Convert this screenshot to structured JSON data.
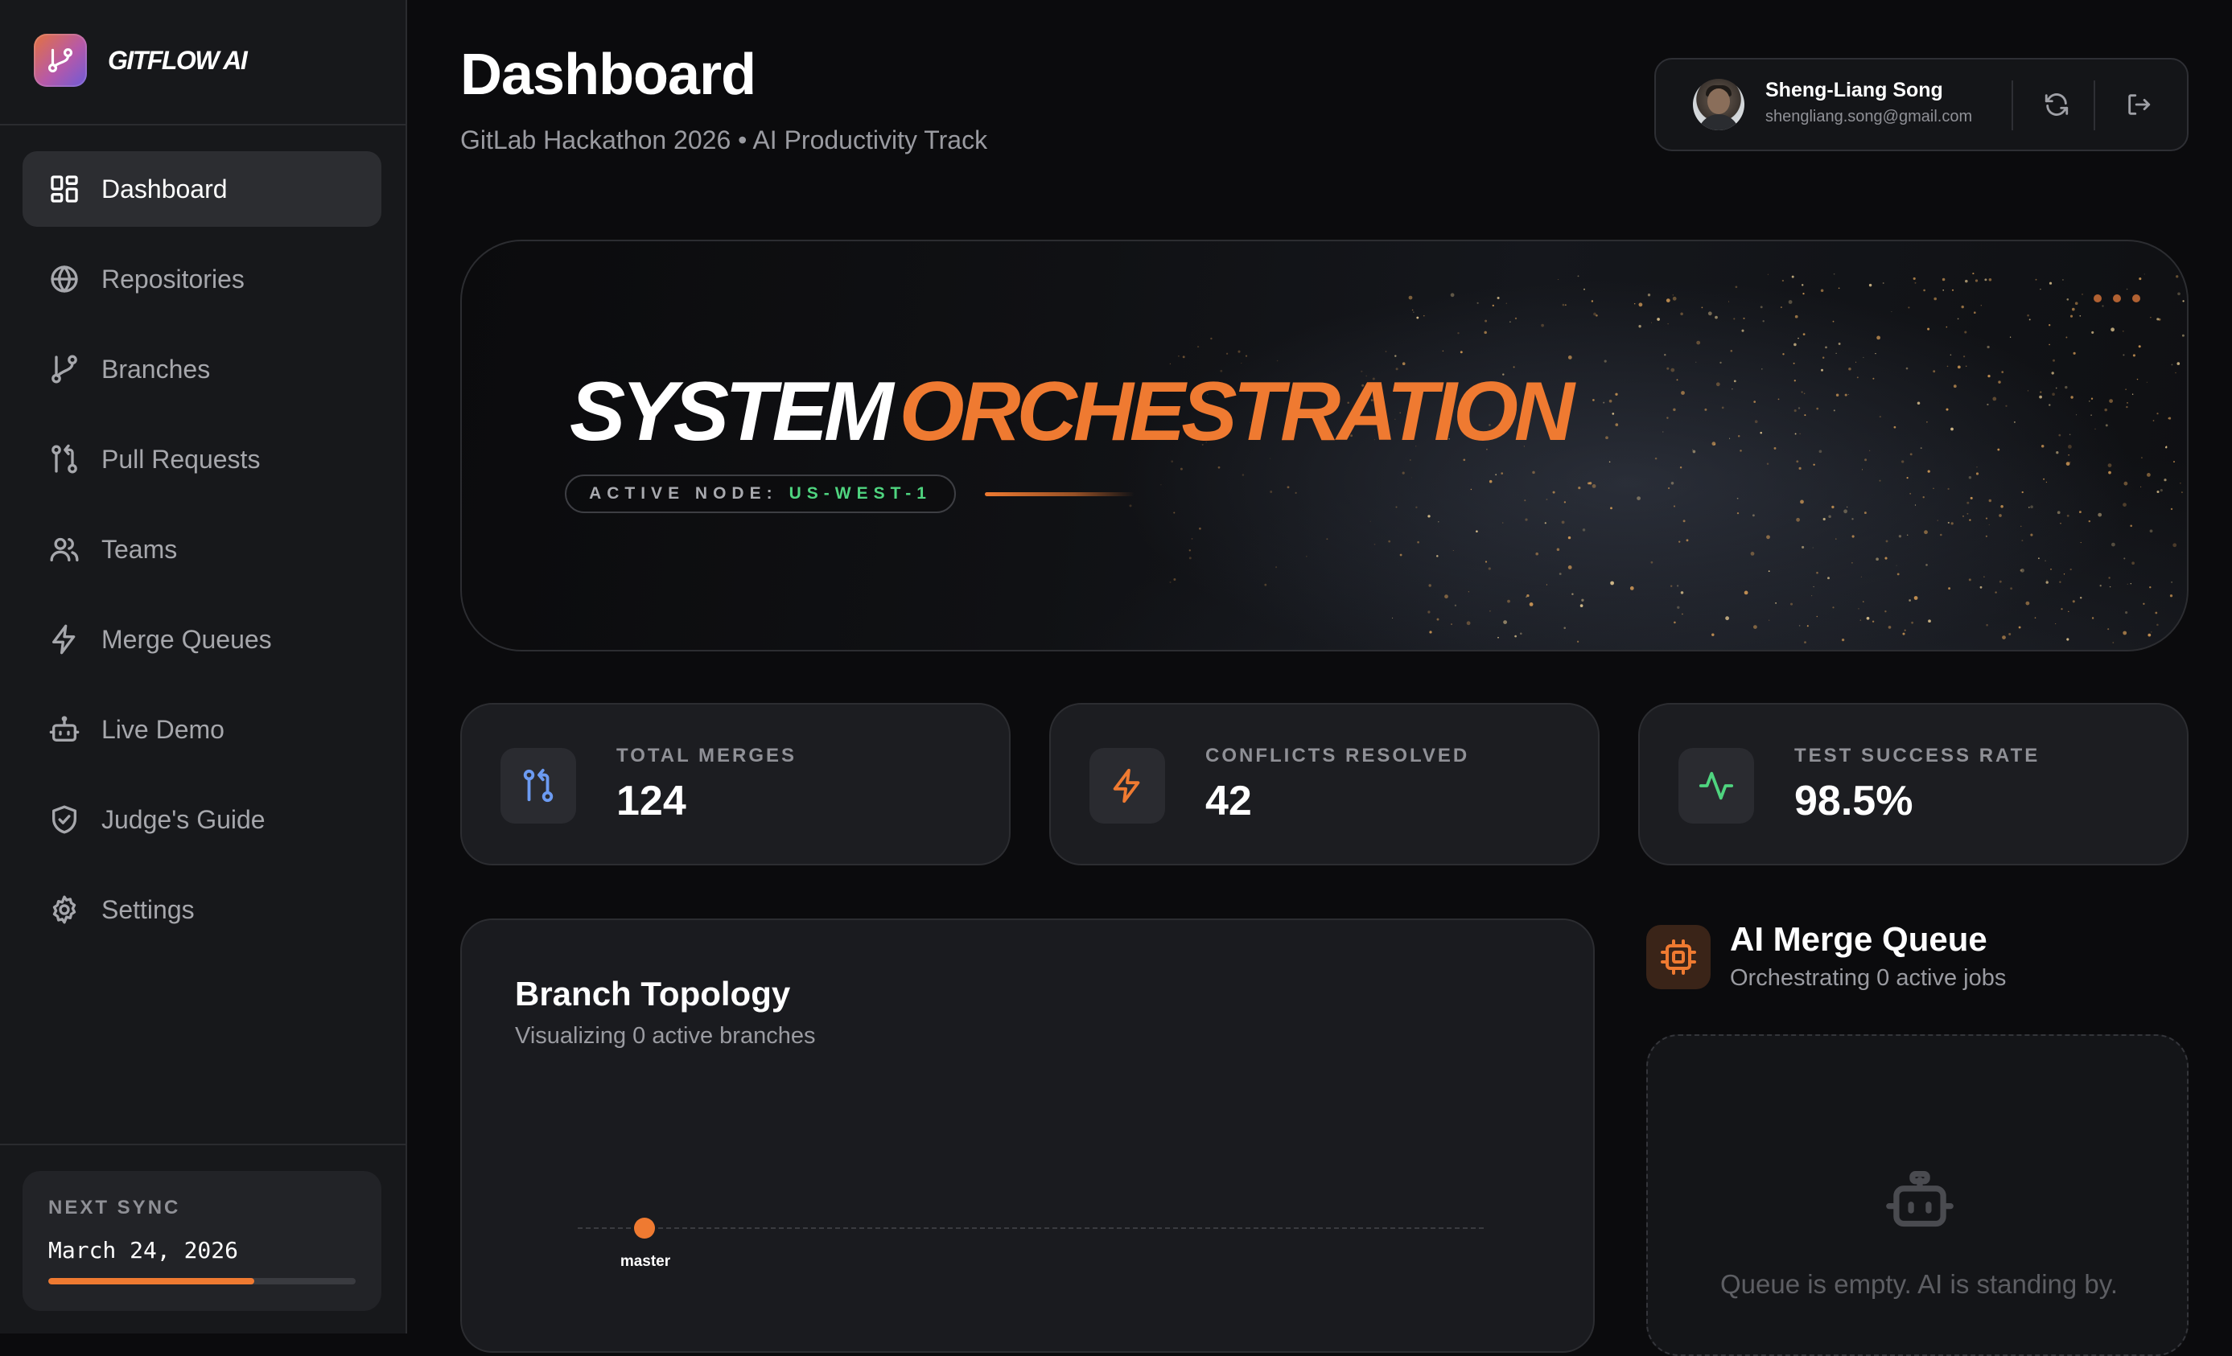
{
  "brand": {
    "name": "GITFLOW AI",
    "icon": "git-branch-icon"
  },
  "sidebar": {
    "items": [
      {
        "label": "Dashboard",
        "icon": "dashboard-grid-icon",
        "active": true
      },
      {
        "label": "Repositories",
        "icon": "globe-icon",
        "active": false
      },
      {
        "label": "Branches",
        "icon": "git-branch-icon",
        "active": false
      },
      {
        "label": "Pull Requests",
        "icon": "git-pull-request-icon",
        "active": false
      },
      {
        "label": "Teams",
        "icon": "users-icon",
        "active": false
      },
      {
        "label": "Merge Queues",
        "icon": "lightning-icon",
        "active": false
      },
      {
        "label": "Live Demo",
        "icon": "robot-icon",
        "active": false
      },
      {
        "label": "Judge's Guide",
        "icon": "shield-check-icon",
        "active": false
      },
      {
        "label": "Settings",
        "icon": "gear-icon",
        "active": false
      }
    ],
    "sync": {
      "label": "NEXT SYNC",
      "date": "March 24, 2026",
      "progress": 0.67
    }
  },
  "header": {
    "title": "Dashboard",
    "subtitle": "GitLab Hackathon 2026 • AI Productivity Track"
  },
  "user": {
    "name": "Sheng-Liang Song",
    "email": "shengliang.song@gmail.com",
    "refresh_icon": "refresh-icon",
    "logout_icon": "logout-icon"
  },
  "hero": {
    "title_white": "SYSTEM",
    "title_orange": "ORCHESTRATION",
    "node_label": "ACTIVE NODE:",
    "node_value": "US-WEST-1"
  },
  "stats": [
    {
      "label": "TOTAL MERGES",
      "value": "124",
      "icon": "git-pull-request-icon",
      "color": "#6c9bf2"
    },
    {
      "label": "CONFLICTS RESOLVED",
      "value": "42",
      "icon": "lightning-icon",
      "color": "#ef7a31"
    },
    {
      "label": "TEST SUCCESS RATE",
      "value": "98.5%",
      "icon": "activity-pulse-icon",
      "color": "#4fd47f"
    }
  ],
  "topology": {
    "title": "Branch Topology",
    "subtitle": "Visualizing 0 active branches",
    "branch": "master"
  },
  "queue": {
    "title": "AI Merge Queue",
    "subtitle": "Orchestrating 0 active jobs",
    "empty_text": "Queue is empty. AI is standing by.",
    "icon": "cpu-chip-icon"
  },
  "colors": {
    "accent": "#ef7a31",
    "success": "#4fd47f",
    "info": "#6c9bf2",
    "background": "#0b0b0d",
    "sidebar": "#17181b"
  }
}
